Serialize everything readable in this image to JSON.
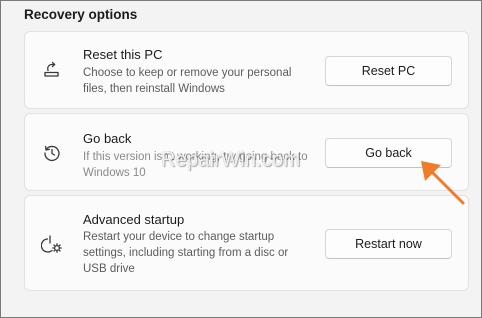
{
  "section": {
    "title": "Recovery options"
  },
  "cards": [
    {
      "title": "Reset this PC",
      "desc": "Choose to keep or remove your personal files, then reinstall Windows",
      "button": "Reset PC",
      "icon": "reset-pc-icon"
    },
    {
      "title": "Go back",
      "desc": "If this version isn't working, try going back to Windows 10",
      "button": "Go back",
      "icon": "history-icon"
    },
    {
      "title": "Advanced startup",
      "desc": "Restart your device to change startup settings, including starting from a disc or USB drive",
      "button": "Restart now",
      "icon": "power-gear-icon"
    }
  ],
  "watermark": "RepairWin.com",
  "colors": {
    "background": "#f3f3f3",
    "card": "#fbfbfb",
    "arrow": "#f07c2a"
  }
}
